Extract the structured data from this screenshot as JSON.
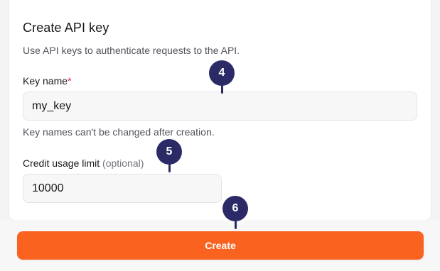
{
  "dialog": {
    "title": "Create API key",
    "subtitle": "Use API keys to authenticate requests to the API."
  },
  "key_name": {
    "label": "Key name",
    "required_mark": "*",
    "value": "my_key",
    "helper": "Key names can't be changed after creation."
  },
  "credit_limit": {
    "label": "Credit usage limit",
    "optional_text": "(optional)",
    "value": "10000"
  },
  "actions": {
    "create_label": "Create"
  },
  "markers": [
    "4",
    "5",
    "6"
  ],
  "colors": {
    "accent": "#f9621f",
    "marker": "#2b2a66",
    "required": "#e11d48"
  }
}
